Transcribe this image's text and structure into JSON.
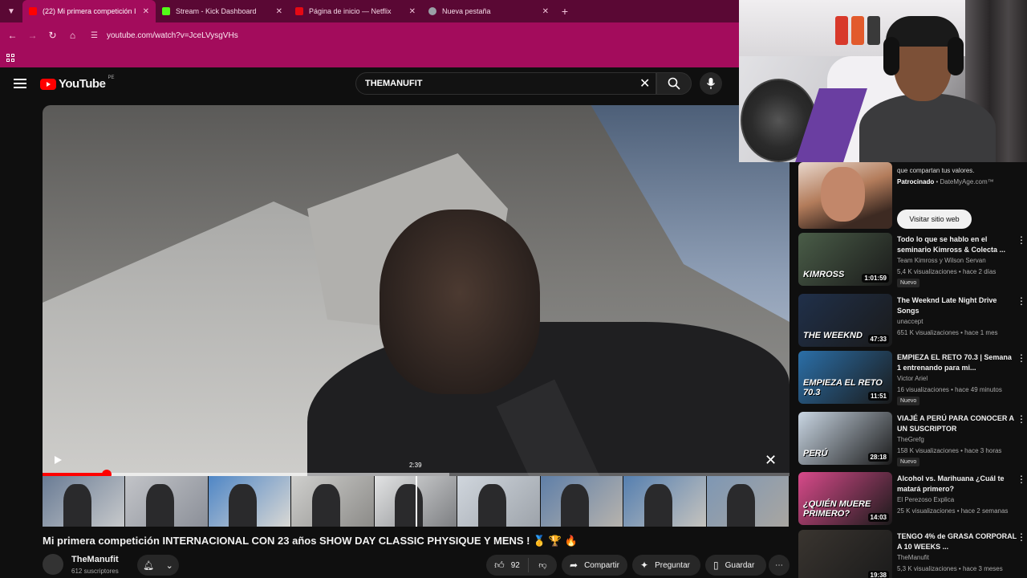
{
  "browser": {
    "tabs": [
      {
        "title": "(22) Mi primera competición I",
        "favicon_color": "#ff0000",
        "active": true
      },
      {
        "title": "Stream - Kick Dashboard",
        "favicon_color": "#53fc18",
        "active": false
      },
      {
        "title": "Página de inicio — Netflix",
        "favicon_color": "#e50914",
        "active": false
      },
      {
        "title": "Nueva pestaña",
        "favicon_color": "#9aa0a6",
        "active": false
      }
    ],
    "new_tab": "+",
    "url": "youtube.com/watch?v=JceLVysgVHs",
    "theme_colors": {
      "tabbar": "#5a0834",
      "toolbar": "#a30c5c"
    }
  },
  "youtube": {
    "logo_text": "YouTube",
    "country_code": "PE",
    "search_value": "THEMANUFIT"
  },
  "video": {
    "preview_time": "2:39",
    "progress_fraction": 0.086,
    "title": "Mi primera competición INTERNACIONAL CON 23 años SHOW DAY CLASSIC PHYSIQUE Y MENS ! 🥇 🏆 🔥",
    "channel": "TheManufit",
    "subscribers": "612 suscriptores",
    "likes": "92",
    "share_label": "Compartir",
    "ask_label": "Preguntar",
    "save_label": "Guardar"
  },
  "sidebar": {
    "ad": {
      "text": "que compartan tus valores.",
      "sponsor_label": "Patrocinado",
      "sponsor_domain": "DateMyAge.com™",
      "cta": "Visitar sitio web"
    },
    "recommendations": [
      {
        "title": "Todo lo que se hablo en el seminario Kimross & Colecta ...",
        "channel": "Team Kimross y Wilson Servan",
        "meta": "5,4 K visualizaciones • hace 2 días",
        "duration": "1:01:59",
        "badge": "Nuevo",
        "thumb_text": "KIMROSS",
        "thumb_color": "#4a5d48"
      },
      {
        "title": "The Weeknd Late Night Drive Songs",
        "channel": "unaccept",
        "meta": "651 K visualizaciones • hace 1 mes",
        "duration": "47:33",
        "badge": "",
        "thumb_text": "THE WEEKND",
        "thumb_color": "#20304a"
      },
      {
        "title": "EMPIEZA EL RETO 70.3 | Semana 1 entrenando para mi...",
        "channel": "Victor Ariel",
        "meta": "16 visualizaciones • hace 49 minutos",
        "duration": "11:51",
        "badge": "Nuevo",
        "thumb_text": "EMPIEZA EL RETO 70.3",
        "thumb_color": "#2b6fa8"
      },
      {
        "title": "VIAJÉ A PERÚ PARA CONOCER A UN SUSCRIPTOR",
        "channel": "TheGrefg",
        "meta": "158 K visualizaciones • hace 3 horas",
        "duration": "28:18",
        "badge": "Nuevo",
        "thumb_text": "PERÚ",
        "thumb_color": "#c9d6e3"
      },
      {
        "title": "Alcohol vs. Marihuana ¿Cuál te matará primero?",
        "channel": "El Perezoso Explica",
        "meta": "25 K visualizaciones • hace 2 semanas",
        "duration": "14:03",
        "badge": "",
        "thumb_text": "¿QUIÉN MUERE PRIMERO?",
        "thumb_color": "#d84a8a"
      },
      {
        "title": "TENGO 4% de GRASA CORPORAL A 10 WEEKS ...",
        "channel": "TheManufit",
        "meta": "5,3 K visualizaciones • hace 3 meses",
        "duration": "19:38",
        "badge": "",
        "thumb_text": "",
        "thumb_color": "#3a3530"
      }
    ]
  }
}
